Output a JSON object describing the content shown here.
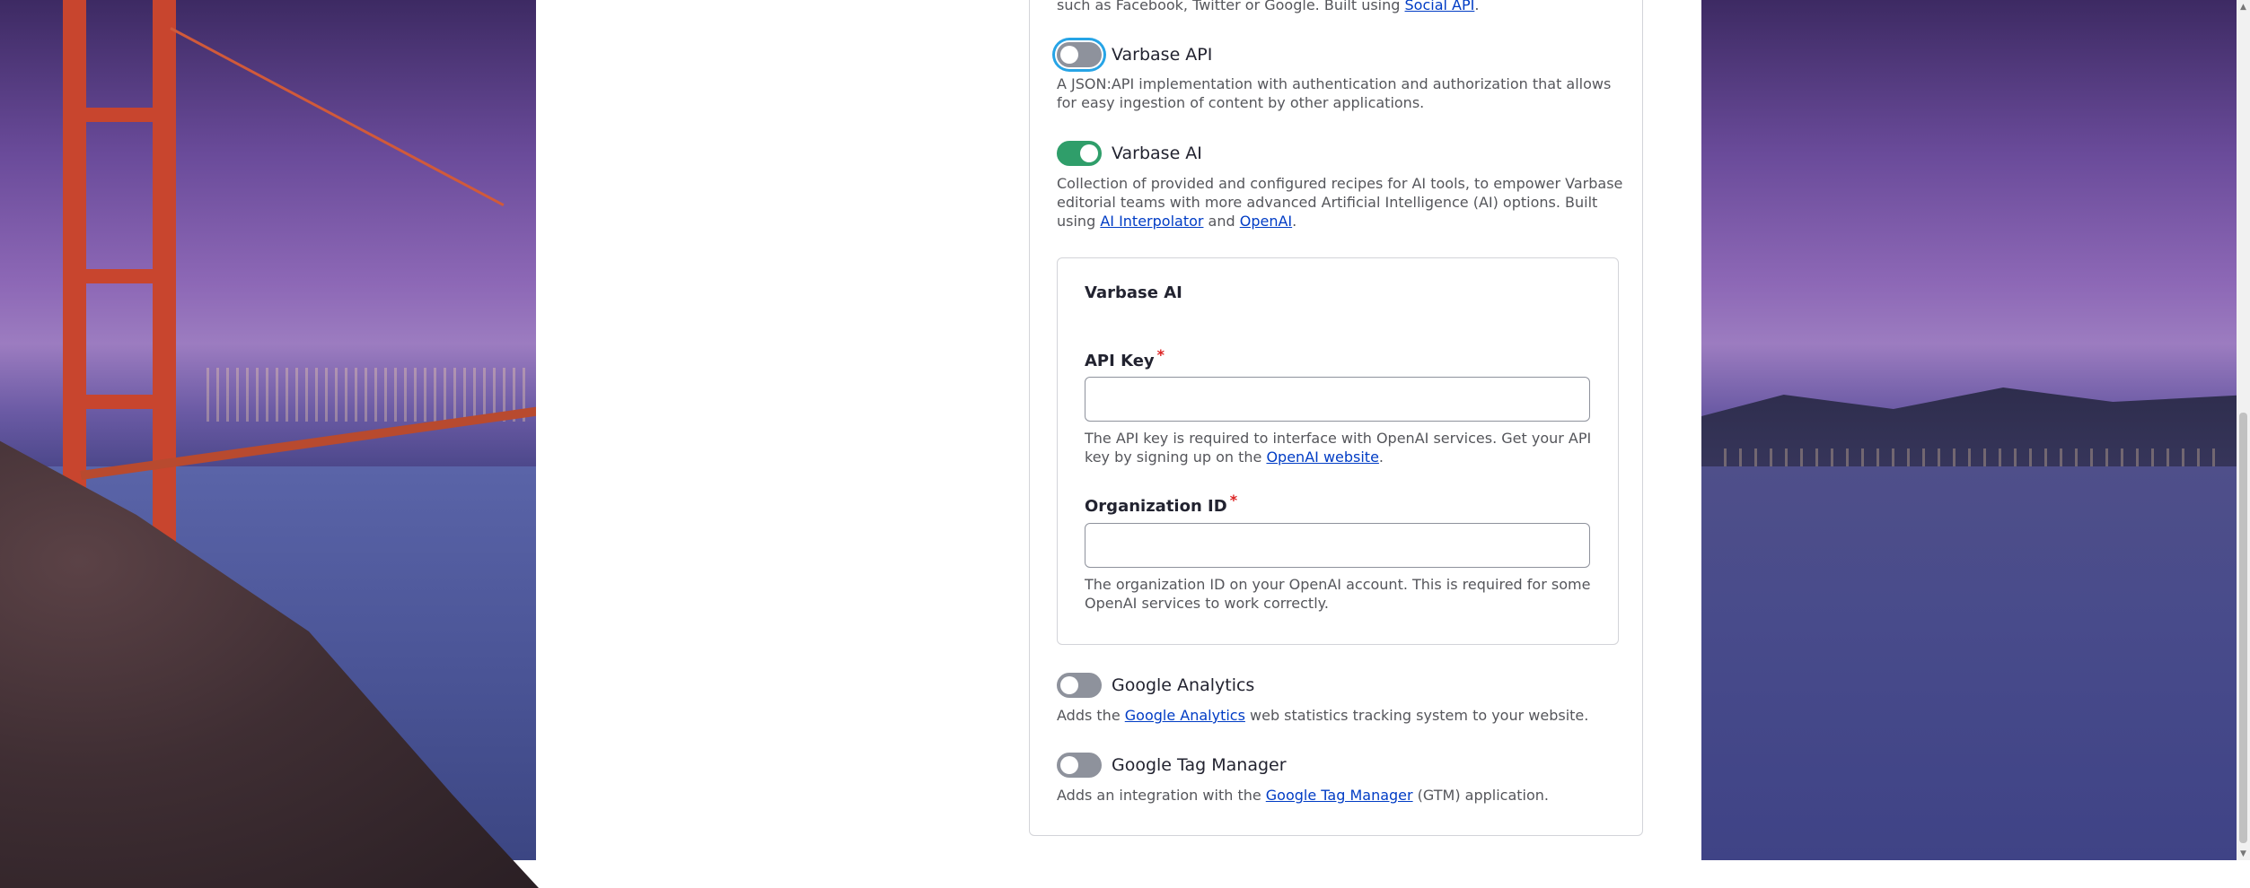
{
  "intro": {
    "text_prefix": "such as Facebook, Twitter or Google. Built using ",
    "link": "Social API",
    "text_suffix": "."
  },
  "modules": [
    {
      "label": "Varbase API",
      "enabled": false,
      "description": "A JSON:API implementation with authentication and authorization that allows for easy ingestion of content by other applications."
    },
    {
      "label": "Varbase AI",
      "enabled": true,
      "description_prefix": "Collection of provided and configured recipes for AI tools, to empower Varbase editorial teams with more advanced Artificial Intelligence (AI) options. Built using ",
      "link1": "AI Interpolator",
      "description_mid": " and ",
      "link2": "OpenAI",
      "description_suffix": "."
    },
    {
      "label": "Google Analytics",
      "enabled": false,
      "description_prefix": "Adds the ",
      "link": "Google Analytics",
      "description_suffix": " web statistics tracking system to your website."
    },
    {
      "label": "Google Tag Manager",
      "enabled": false,
      "description_prefix": "Adds an integration with the ",
      "link": "Google Tag Manager",
      "description_suffix": " (GTM) application."
    }
  ],
  "ai_settings": {
    "title": "Varbase AI",
    "api_key": {
      "label": "API Key",
      "required_marker": "*",
      "value": "",
      "description_prefix": "The API key is required to interface with OpenAI services. Get your API key by signing up on the ",
      "link": "OpenAI website",
      "description_suffix": "."
    },
    "org_id": {
      "label": "Organization ID",
      "required_marker": "*",
      "value": "",
      "description": "The organization ID on your OpenAI account. This is required for some OpenAI services to work correctly."
    }
  },
  "colors": {
    "toggle_on": "#2f9e6a",
    "toggle_off": "#8e929c",
    "link": "#003cc5",
    "required": "#dc2323",
    "focus_ring": "#26a4e6"
  }
}
